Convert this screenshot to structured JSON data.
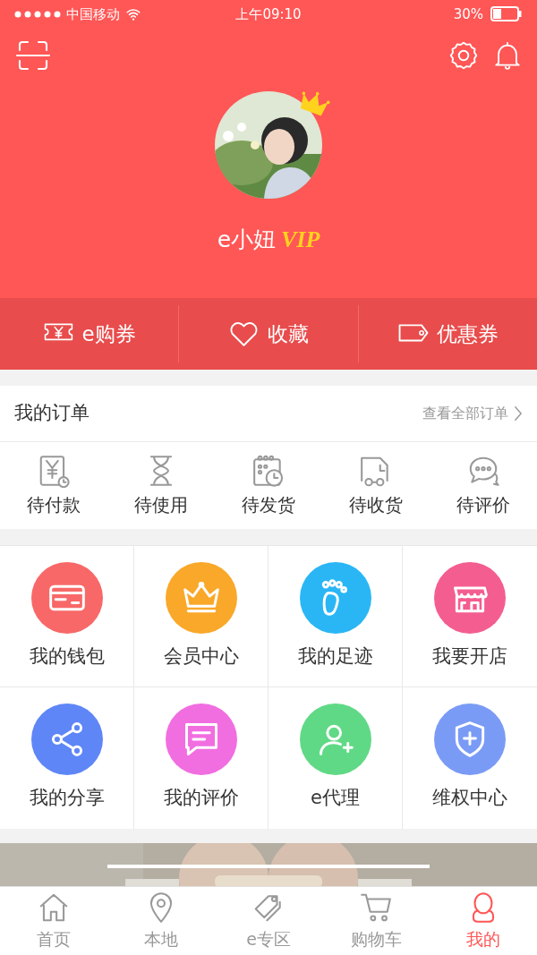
{
  "status_bar": {
    "carrier": "中国移动",
    "time": "上午09:10",
    "battery": "30%"
  },
  "profile": {
    "name": "e小妞",
    "badge": "VIP"
  },
  "quick_links": [
    {
      "label": "e购券"
    },
    {
      "label": "收藏"
    },
    {
      "label": "优惠券"
    }
  ],
  "orders": {
    "title": "我的订单",
    "link": "查看全部订单",
    "items": [
      {
        "label": "待付款"
      },
      {
        "label": "待使用"
      },
      {
        "label": "待发货"
      },
      {
        "label": "待收货"
      },
      {
        "label": "待评价"
      }
    ]
  },
  "services": [
    {
      "label": "我的钱包",
      "color": "#f86868"
    },
    {
      "label": "会员中心",
      "color": "#f9a82a"
    },
    {
      "label": "我的足迹",
      "color": "#2ab6f5"
    },
    {
      "label": "我要开店",
      "color": "#f45d90"
    },
    {
      "label": "我的分享",
      "color": "#5f86f7"
    },
    {
      "label": "我的评价",
      "color": "#f16ee0"
    },
    {
      "label": "e代理",
      "color": "#60d986"
    },
    {
      "label": "维权中心",
      "color": "#7a9bf5"
    }
  ],
  "tab_bar": [
    {
      "label": "首页",
      "selected": false
    },
    {
      "label": "本地",
      "selected": false
    },
    {
      "label": "e专区",
      "selected": false
    },
    {
      "label": "购物车",
      "selected": false
    },
    {
      "label": "我的",
      "selected": true
    }
  ]
}
